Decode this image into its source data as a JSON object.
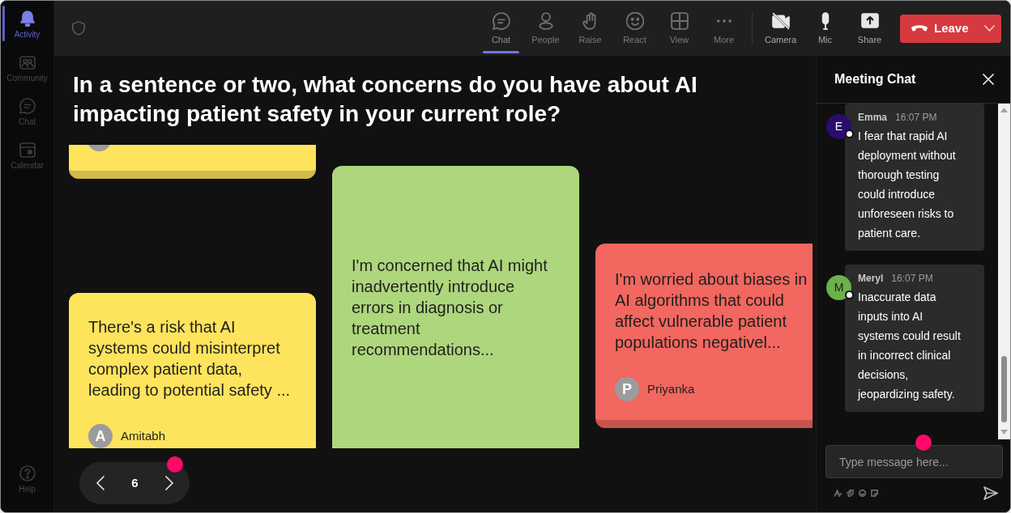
{
  "sidebar": {
    "items": [
      {
        "label": "Activity",
        "selected": true
      },
      {
        "label": "Community",
        "selected": false
      },
      {
        "label": "Chat",
        "selected": false
      },
      {
        "label": "Calendar",
        "selected": false
      }
    ],
    "help": {
      "label": "Help"
    }
  },
  "toolbar": {
    "items": [
      {
        "label": "Chat",
        "selected": true
      },
      {
        "label": "People",
        "selected": false
      },
      {
        "label": "Raise",
        "selected": false
      },
      {
        "label": "React",
        "selected": false
      },
      {
        "label": "View",
        "selected": false
      },
      {
        "label": "More",
        "selected": false
      }
    ],
    "devices": [
      {
        "label": "Camera"
      },
      {
        "label": "Mic"
      },
      {
        "label": "Share"
      }
    ],
    "leave_button": {
      "label": "Leave"
    }
  },
  "question": {
    "title": "In a sentence or two, what concerns do you have about AI impacting patient safety in your current role?"
  },
  "board": {
    "columns": [
      {
        "notes": [
          {
            "kind": "tail",
            "color": "#fee45c"
          },
          {
            "kind": "cut",
            "color": "#fee45c",
            "text": "There's a risk that AI systems could misinterpret complex patient data, leading to potential safety ...",
            "author": {
              "initial": "A",
              "name": "Amitabh"
            }
          }
        ]
      },
      {
        "notes": [
          {
            "kind": "cut",
            "color": "#aed67c",
            "text": "I'm concerned that AI might inadvertently introduce errors in diagnosis or treatment recommendations..."
          }
        ]
      },
      {
        "notes": [
          {
            "kind": "full",
            "color": "#f2675f",
            "text": "I'm worried about biases in AI algorithms that could affect vulnerable patient populations negativel...",
            "author": {
              "initial": "P",
              "name": "Priyanka"
            }
          }
        ]
      }
    ]
  },
  "pagination": {
    "page": "6"
  },
  "chat": {
    "title": "Meeting Chat",
    "messages": [
      {
        "author": "Emma",
        "initial": "E",
        "color": "#2b0b6e",
        "time": "16:07 PM",
        "text": "I fear that rapid AI deployment without thorough testing could introduce unforeseen risks to patient care."
      },
      {
        "author": "Meryl",
        "initial": "M",
        "color": "#6bb24a",
        "time": "16:07 PM",
        "text": "Inaccurate data inputs into AI systems could result in incorrect clinical decisions, jeopardizing safety."
      }
    ],
    "input": {
      "placeholder": "Type message here..."
    }
  }
}
